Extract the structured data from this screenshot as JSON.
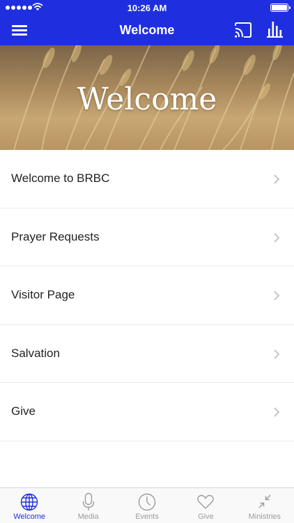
{
  "status_bar": {
    "time": "10:26 AM"
  },
  "nav": {
    "title": "Welcome",
    "menu_icon": "hamburger-icon",
    "cast_icon": "cast-icon",
    "stats_icon": "bar-chart-icon"
  },
  "hero": {
    "title": "Welcome"
  },
  "list": {
    "items": [
      {
        "label": "Welcome to BRBC"
      },
      {
        "label": "Prayer Requests"
      },
      {
        "label": "Visitor Page"
      },
      {
        "label": "Salvation"
      },
      {
        "label": "Give"
      }
    ]
  },
  "tabs": [
    {
      "label": "Welcome",
      "icon": "globe-icon",
      "active": true
    },
    {
      "label": "Media",
      "icon": "microphone-icon",
      "active": false
    },
    {
      "label": "Events",
      "icon": "clock-icon",
      "active": false
    },
    {
      "label": "Give",
      "icon": "heart-icon",
      "active": false
    },
    {
      "label": "Ministries",
      "icon": "collapse-arrows-icon",
      "active": false
    }
  ],
  "colors": {
    "accent": "#1f2fe0",
    "tab_inactive": "#9b9b9b"
  }
}
